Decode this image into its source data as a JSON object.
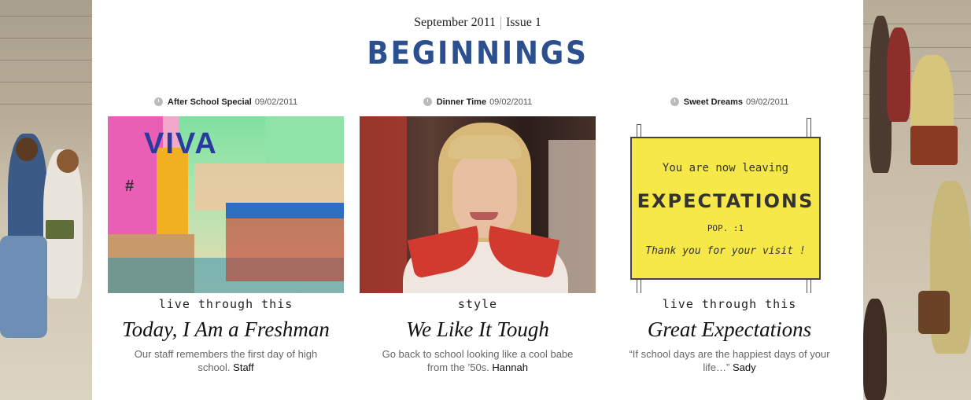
{
  "issue": {
    "date": "September 2011",
    "number": "Issue 1",
    "title": "BEGINNINGS"
  },
  "articles": [
    {
      "category": "After School Special",
      "date": "09/02/2011",
      "tag": "live through this",
      "headline": "Today, I Am a Freshman",
      "dek": "Our staff remembers the first day of high school.",
      "author": "Staff"
    },
    {
      "category": "Dinner Time",
      "date": "09/02/2011",
      "tag": "style",
      "headline": "We Like It Tough",
      "dek": "Go back to school looking like a cool babe from the ’50s.",
      "author": "Hannah"
    },
    {
      "category": "Sweet Dreams",
      "date": "09/02/2011",
      "tag": "live through this",
      "headline": "Great Expectations",
      "dek": "“If school days are the happiest days of your life…”",
      "author": "Sady"
    }
  ],
  "art1": {
    "text": "VIVA",
    "hash": "#"
  },
  "sign": {
    "line1": "You are now leaving",
    "line2": "EXPECTATIONS",
    "line3": "POP. :1",
    "line4": "Thank you for your visit !"
  },
  "colors": {
    "title_blue": "#2b4f8f",
    "sign_yellow": "#f7e84a",
    "background_photo": "#cfc6b4"
  },
  "icons": [
    "clock-icon"
  ]
}
